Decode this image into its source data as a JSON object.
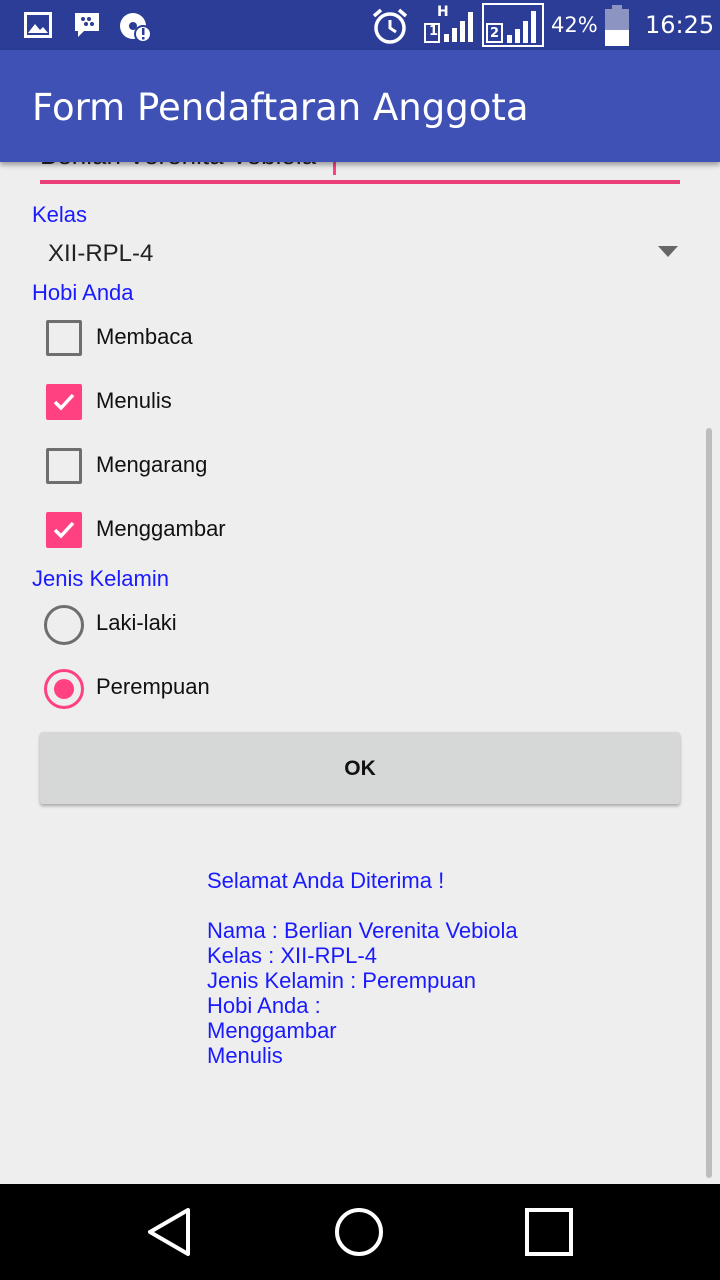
{
  "status_bar": {
    "icons": [
      "image-icon",
      "bbm-icon",
      "sync-alert-icon",
      "alarm-icon",
      "signal-sim1-icon",
      "signal-sim2-icon",
      "battery-icon"
    ],
    "network_type": "H",
    "sim1_label": "1",
    "sim2_label": "2",
    "battery_percent": "42%",
    "time": "16:25",
    "colors": {
      "background": "#2b3d96"
    }
  },
  "app_bar": {
    "title": "Form Pendaftaran Anggota",
    "color": "#3f51b5"
  },
  "form": {
    "name_value": "Berlian Verenita Vebiola",
    "kelas_label": "Kelas",
    "kelas_selected": "XII-RPL-4",
    "hobi_label": "Hobi Anda",
    "hobbies": [
      {
        "label": "Membaca",
        "checked": false
      },
      {
        "label": "Menulis",
        "checked": true
      },
      {
        "label": "Mengarang",
        "checked": false
      },
      {
        "label": "Menggambar",
        "checked": true
      }
    ],
    "gender_label": "Jenis Kelamin",
    "genders": [
      {
        "label": "Laki-laki",
        "selected": false
      },
      {
        "label": "Perempuan",
        "selected": true
      }
    ],
    "ok_label": "OK",
    "accent_color": "#ff4081",
    "label_color": "#1a1aff"
  },
  "result": {
    "greeting": "Selamat Anda Diterima !",
    "nama": "Nama : Berlian Verenita Vebiola",
    "kelas": "Kelas : XII-RPL-4",
    "jenis_kelamin": "Jenis Kelamin : Perempuan",
    "hobi_header": "Hobi Anda :",
    "hobi_items": [
      "Menggambar",
      "Menulis"
    ]
  },
  "nav_bar": {
    "icons": [
      "back-icon",
      "home-icon",
      "recents-icon"
    ]
  }
}
